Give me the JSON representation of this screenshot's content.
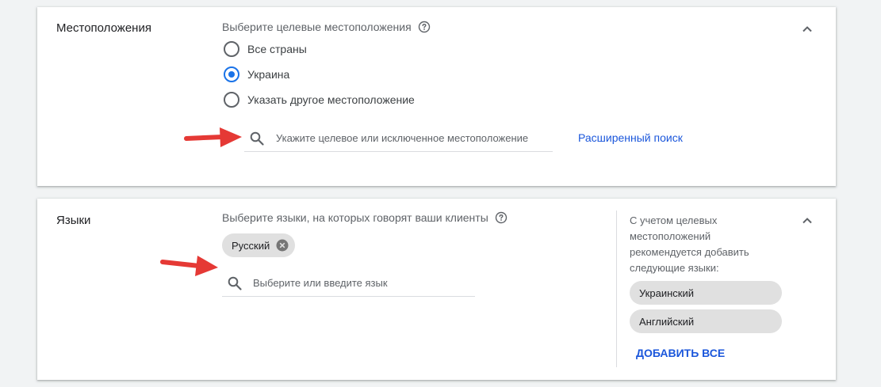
{
  "locations": {
    "title": "Местоположения",
    "prompt": "Выберите целевые местоположения",
    "options": [
      {
        "label": "Все страны",
        "selected": false
      },
      {
        "label": "Украина",
        "selected": true
      },
      {
        "label": "Указать другое местоположение",
        "selected": false
      }
    ],
    "search_placeholder": "Укажите целевое или исключенное местоположение",
    "advanced_search_label": "Расширенный поиск"
  },
  "languages": {
    "title": "Языки",
    "prompt": "Выберите языки, на которых говорят ваши клиенты",
    "selected_chips": [
      "Русский"
    ],
    "search_placeholder": "Выберите или введите язык",
    "recommendation_text": "С учетом целевых местоположений рекомендуется добавить следующие языки:",
    "suggested_chips": [
      "Украинский",
      "Английский"
    ],
    "add_all_label": "ДОБАВИТЬ ВСЕ"
  },
  "icons": {
    "help": "help-circle-icon",
    "search": "search-icon",
    "collapse": "chevron-up-icon",
    "remove": "close-circle-icon",
    "annotation": "red-arrow-icon"
  },
  "colors": {
    "accent": "#1a73e8",
    "link": "#1a56db",
    "annotation_arrow": "#e53935",
    "chip_bg": "#e0e0e0"
  }
}
